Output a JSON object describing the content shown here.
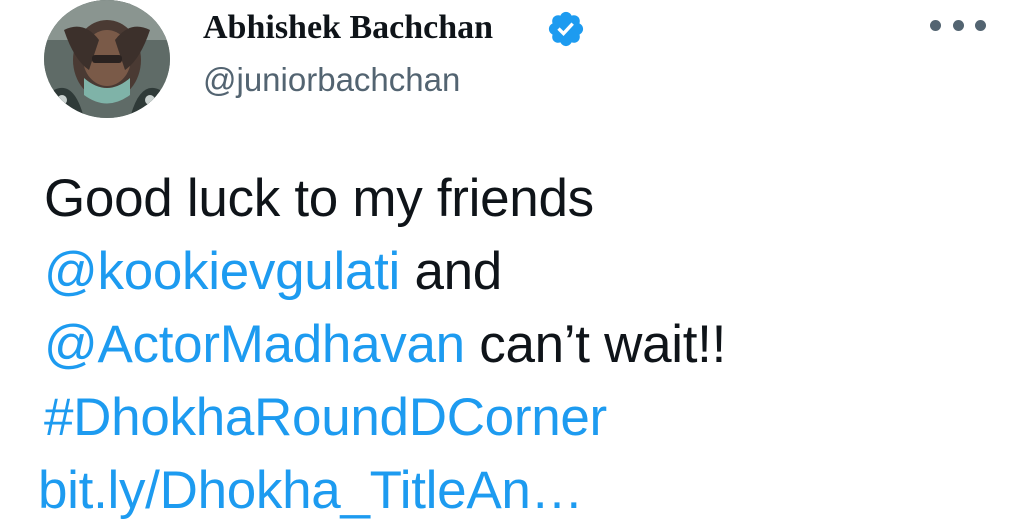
{
  "author": {
    "name": "Abhishek Bachchan",
    "handle": "@juniorbachchan",
    "verified_icon": "verified-badge-icon",
    "avatar_icon": "profile-avatar"
  },
  "menu": {
    "more_icon": "more-options-icon"
  },
  "tweet": {
    "line1": "Good luck to my friends",
    "mention1": "@kookievgulati",
    "and_text": " and",
    "mention2": "@ActorMadhavan",
    "cant_wait": " can’t wait!!",
    "hashtag": "#DhokhaRoundDCorner",
    "url": "bit.ly/Dhokha_TitleAn…"
  },
  "colors": {
    "link": "#1d9bf0",
    "text": "#0f1419",
    "secondary": "#536471",
    "verified": "#1d9bf0"
  }
}
